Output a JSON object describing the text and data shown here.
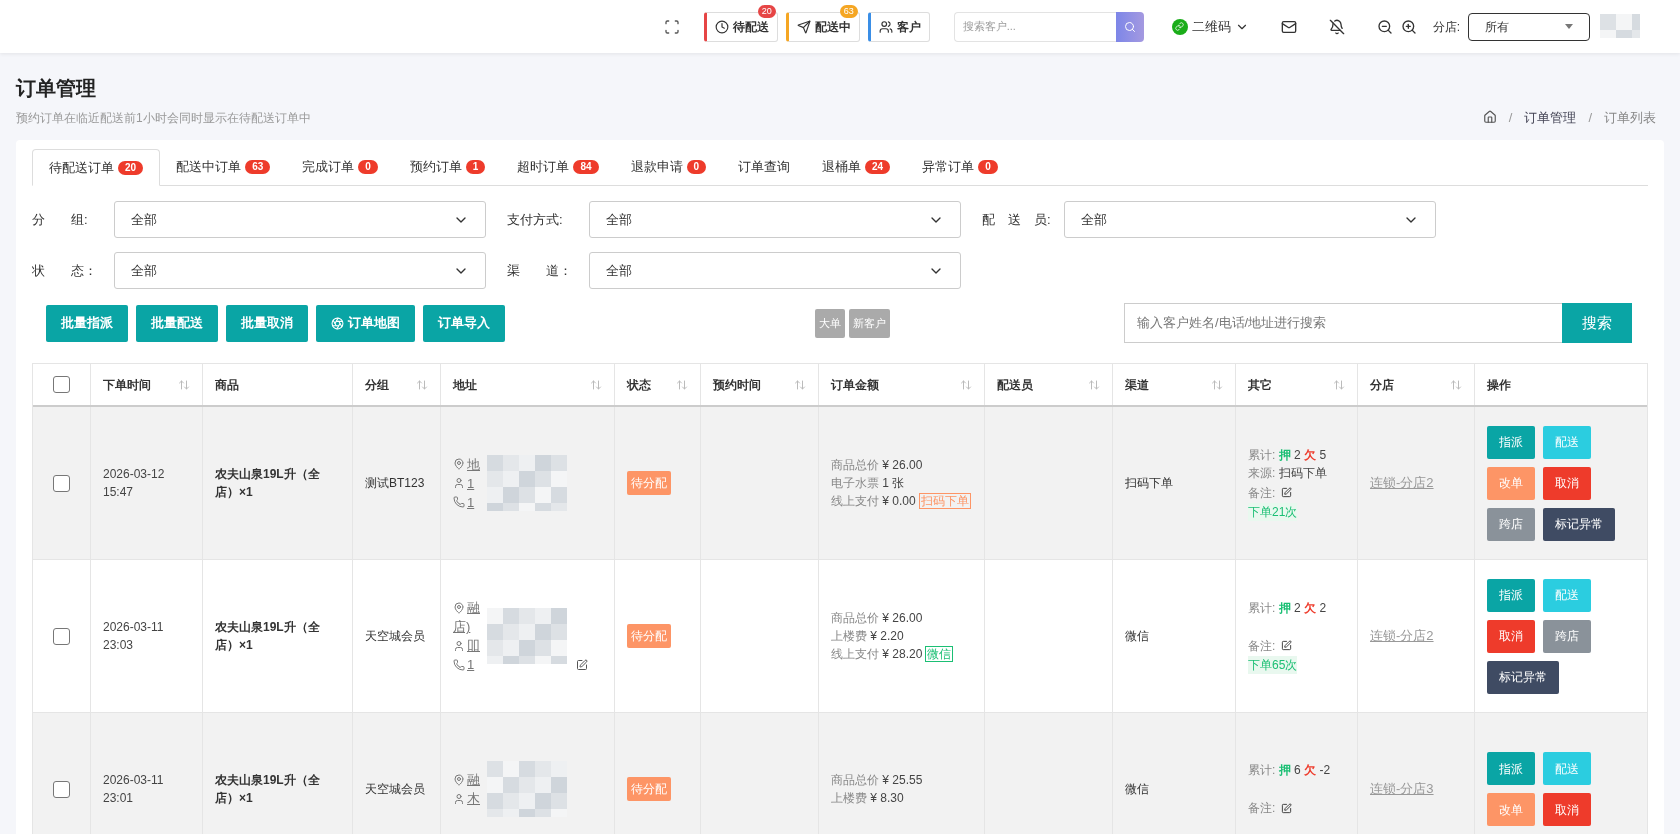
{
  "topbar": {
    "quick": [
      {
        "kind": "pending",
        "label": "待配送",
        "badge": "20",
        "color": "#e64545"
      },
      {
        "kind": "delivering",
        "label": "配送中",
        "badge": "63",
        "color": "#f5a623"
      },
      {
        "kind": "customer",
        "label": "客户",
        "color": "#3a8ee6"
      }
    ],
    "search": {
      "placeholder": "搜索客户..."
    },
    "qrcode": "二维码",
    "branch_label": "分店:",
    "branch_value": "所有"
  },
  "page": {
    "title": "订单管理",
    "subtitle": "预约订单在临近配送前1小时会同时显示在待配送订单中",
    "breadcrumb": [
      "订单管理",
      "订单列表"
    ],
    "breadcrumb_separator": "/"
  },
  "tabs": [
    {
      "label": "待配送订单",
      "badge": "20",
      "selected": true
    },
    {
      "label": "配送中订单",
      "badge": "63",
      "selected": false
    },
    {
      "label": "完成订单",
      "badge": "0",
      "selected": false
    },
    {
      "label": "预约订单",
      "badge": "1",
      "selected": false
    },
    {
      "label": "超时订单",
      "badge": "84",
      "selected": false
    },
    {
      "label": "退款申请",
      "badge": "0",
      "selected": false
    },
    {
      "label": "订单查询",
      "selected": false
    },
    {
      "label": "退桶单",
      "badge": "24",
      "selected": false
    },
    {
      "label": "异常订单",
      "badge": "0",
      "selected": false
    }
  ],
  "filters": [
    [
      {
        "label": "分　　组:",
        "value": "全部"
      },
      {
        "label": "支付方式:",
        "value": "全部"
      },
      {
        "label": "配　送　员:",
        "value": "全部"
      }
    ],
    [
      {
        "label": "状　　态：",
        "value": "全部"
      },
      {
        "label": "渠　　道：",
        "value": "全部"
      }
    ]
  ],
  "actions": [
    {
      "label": "批量指派"
    },
    {
      "label": "批量配送"
    },
    {
      "label": "批量取消"
    },
    {
      "label": "订单地图",
      "kind": "map"
    },
    {
      "label": "订单导入"
    }
  ],
  "quick_tags": [
    "大单",
    "新客户"
  ],
  "order_search": {
    "placeholder": "输入客户姓名/电话/地址进行搜索",
    "button": "搜索"
  },
  "table": {
    "select_all": {
      "checked": false
    },
    "columns": [
      {
        "label": "下单时间",
        "sortable": true
      },
      {
        "label": "商品",
        "sortable": false
      },
      {
        "label": "分组",
        "sortable": true
      },
      {
        "label": "地址",
        "sortable": true
      },
      {
        "label": "状态",
        "sortable": true
      },
      {
        "label": "预约时间",
        "sortable": true
      },
      {
        "label": "订单金额",
        "sortable": true
      },
      {
        "label": "配送员",
        "sortable": true
      },
      {
        "label": "渠道",
        "sortable": true
      },
      {
        "label": "其它",
        "sortable": true
      },
      {
        "label": "分店",
        "sortable": true
      },
      {
        "label": "操作",
        "sortable": false
      }
    ],
    "rows": [
      {
        "checked": false,
        "time": [
          "2026-03-12",
          "15:47"
        ],
        "product": "农夫山泉19L升（全店）×1",
        "group": "测试BT123",
        "address": [
          {
            "kind": "location",
            "text": "地"
          },
          {
            "kind": "person",
            "text": "1"
          },
          {
            "kind": "phone",
            "text": "1"
          }
        ],
        "status": "待分配",
        "amount": [
          {
            "label": "商品总价",
            "value": "¥ 26.00"
          },
          {
            "label": "电子水票",
            "value": "1 张"
          },
          {
            "label": "线上支付",
            "value": "¥ 0.00",
            "tag": {
              "kind": "scan",
              "text": "扫码下单"
            }
          }
        ],
        "channel": "扫码下单",
        "other": {
          "cumulative": {
            "label": "累计:",
            "deposit_label": "押",
            "deposit": "2",
            "owe_label": "欠",
            "owe": "5"
          },
          "source": {
            "label": "来源:",
            "value": "扫码下单"
          },
          "remark": "备注:",
          "orders": "下单21次"
        },
        "branch": "连锁-分店2",
        "buttons": [
          {
            "kind": "assign",
            "label": "指派"
          },
          {
            "kind": "deliver",
            "label": "配送"
          },
          {
            "kind": "edit",
            "label": "改单"
          },
          {
            "kind": "cancel",
            "label": "取消"
          },
          {
            "kind": "cross",
            "label": "跨店"
          },
          {
            "kind": "abnormal",
            "label": "标记异常"
          }
        ]
      },
      {
        "checked": false,
        "time": [
          "2026-03-11",
          "23:03"
        ],
        "product": "农夫山泉19L升（全店）×1",
        "group": "天空城会员",
        "address": [
          {
            "kind": "location",
            "text": "融"
          },
          {
            "kind": "plain",
            "text": "店)"
          },
          {
            "kind": "person",
            "text": "吅"
          },
          {
            "kind": "phone",
            "text": "1",
            "editable": true
          }
        ],
        "status": "待分配",
        "amount": [
          {
            "label": "商品总价",
            "value": "¥ 26.00"
          },
          {
            "label": "上楼费",
            "value": "¥ 2.20"
          },
          {
            "label": "线上支付",
            "value": "¥ 28.20",
            "tag": {
              "kind": "wechat",
              "text": "微信"
            }
          }
        ],
        "channel": "微信",
        "other": {
          "cumulative": {
            "label": "累计:",
            "deposit_label": "押",
            "deposit": "2",
            "owe_label": "欠",
            "owe": "2"
          },
          "remark": "备注:",
          "orders": "下单65次"
        },
        "branch": "连锁-分店2",
        "buttons": [
          {
            "kind": "assign",
            "label": "指派"
          },
          {
            "kind": "deliver",
            "label": "配送"
          },
          {
            "kind": "cancel",
            "label": "取消"
          },
          {
            "kind": "cross",
            "label": "跨店"
          },
          {
            "kind": "abnormal",
            "label": "标记异常"
          }
        ]
      },
      {
        "checked": false,
        "time": [
          "2026-03-11",
          "23:01"
        ],
        "product": "农夫山泉19L升（全店）×1",
        "group": "天空城会员",
        "address": [
          {
            "kind": "location",
            "text": "融"
          },
          {
            "kind": "person",
            "text": "木"
          }
        ],
        "status": "待分配",
        "amount": [
          {
            "label": "商品总价",
            "value": "¥ 25.55"
          },
          {
            "label": "上楼费",
            "value": "¥ 8.30"
          }
        ],
        "channel": "微信",
        "other": {
          "cumulative": {
            "label": "累计:",
            "deposit_label": "押",
            "deposit": "6",
            "owe_label": "欠",
            "owe": "-2"
          },
          "remark": "备注:"
        },
        "branch": "连锁-分店3",
        "buttons": [
          {
            "kind": "assign",
            "label": "指派"
          },
          {
            "kind": "deliver",
            "label": "配送"
          },
          {
            "kind": "edit",
            "label": "改单"
          },
          {
            "kind": "cancel",
            "label": "取消"
          }
        ]
      }
    ]
  }
}
